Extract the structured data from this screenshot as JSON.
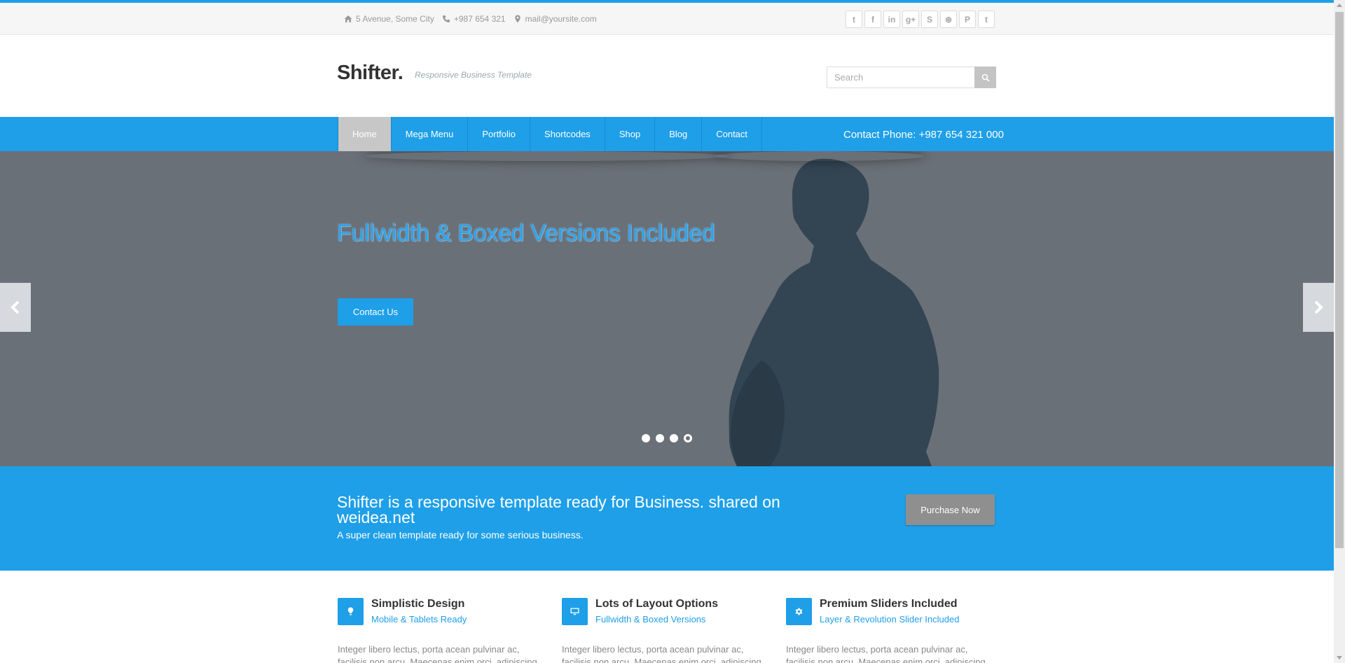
{
  "topbar": {
    "address": "5 Avenue, Some City",
    "phone": "+987 654 321",
    "email": "mail@yoursite.com",
    "social": [
      {
        "name": "twitter-icon",
        "glyph": "t"
      },
      {
        "name": "facebook-icon",
        "glyph": "f"
      },
      {
        "name": "linkedin-icon",
        "glyph": "in"
      },
      {
        "name": "google-plus-icon",
        "glyph": "g+"
      },
      {
        "name": "skype-icon",
        "glyph": "S"
      },
      {
        "name": "dribbble-icon",
        "glyph": "⊛"
      },
      {
        "name": "pinterest-icon",
        "glyph": "P"
      },
      {
        "name": "tumblr-icon",
        "glyph": "t"
      }
    ]
  },
  "header": {
    "logo": "Shifter.",
    "tagline": "Responsive Business Template",
    "search_placeholder": "Search"
  },
  "nav": {
    "items": [
      "Home",
      "Mega Menu",
      "Portfolio",
      "Shortcodes",
      "Shop",
      "Blog",
      "Contact"
    ],
    "active_index": 0,
    "contact_phone": "Contact Phone: +987 654 321 000"
  },
  "hero": {
    "headline": "Fullwidth & Boxed Versions Included",
    "cta_label": "Contact Us",
    "slide_count": 4,
    "active_slide": 4
  },
  "promo": {
    "title": "Shifter is a responsive template ready for Business. shared on weidea.net",
    "subtitle": "A super clean template ready for some serious business.",
    "button_label": "Purchase Now"
  },
  "features": [
    {
      "icon": "lightbulb-icon",
      "title": "Simplistic Design",
      "subtitle": "Mobile & Tablets Ready",
      "body": "Integer libero lectus, porta acean pulvinar ac, facilisis non arcu. Maecenas enim orci, adipiscing"
    },
    {
      "icon": "monitor-icon",
      "title": "Lots of Layout Options",
      "subtitle": "Fullwidth & Boxed Versions",
      "body": "Integer libero lectus, porta acean pulvinar ac, facilisis non arcu. Maecenas enim orci, adipiscing"
    },
    {
      "icon": "gear-icon",
      "title": "Premium Sliders Included",
      "subtitle": "Layer & Revolution Slider Included",
      "body": "Integer libero lectus, porta acean pulvinar ac, facilisis non arcu. Maecenas enim orci, adipiscing"
    }
  ],
  "colors": {
    "accent": "#1e9fe8",
    "hero_bg": "#6a7078",
    "silhouette": "#334452"
  }
}
